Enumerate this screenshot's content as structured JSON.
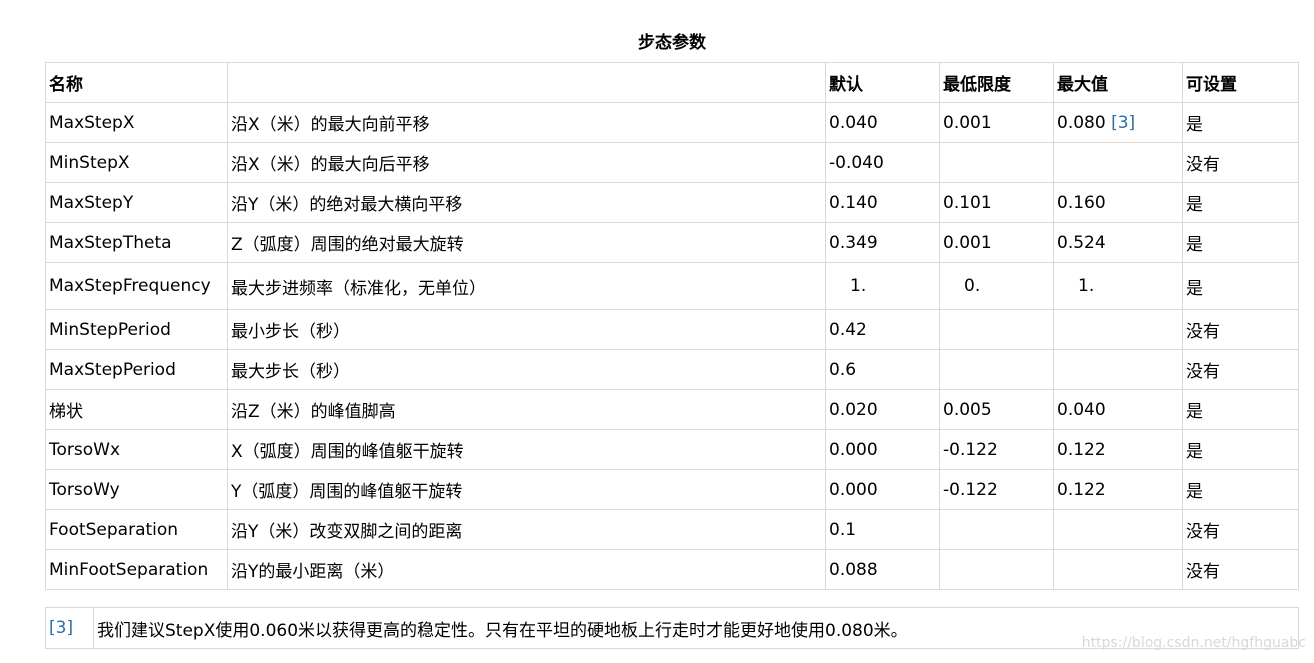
{
  "caption": "步态参数",
  "headers": [
    "名称",
    "",
    "默认",
    "最低限度",
    "最大值",
    "可设置"
  ],
  "rows": [
    {
      "name": "MaxStepX",
      "desc": "沿X（米）的最大向前平移",
      "default": "0.040",
      "min": "0.001",
      "max": "0.080",
      "max_ref": "[3]",
      "settable": "是"
    },
    {
      "name": "MinStepX",
      "desc": "沿X（米）的最大向后平移",
      "default": "-0.040",
      "min": "",
      "max": "",
      "max_ref": "",
      "settable": "没有"
    },
    {
      "name": "MaxStepY",
      "desc": "沿Y（米）的绝对最大横向平移",
      "default": "0.140",
      "min": "0.101",
      "max": "0.160",
      "max_ref": "",
      "settable": "是"
    },
    {
      "name": "MaxStepTheta",
      "desc": "Z（弧度）周围的绝对最大旋转",
      "default": "0.349",
      "min": "0.001",
      "max": "0.524",
      "max_ref": "",
      "settable": "是"
    },
    {
      "name": "MaxStepFrequency",
      "desc": "最大步进频率（标准化，无单位）",
      "default": "1.",
      "min": "0.",
      "max": "1.",
      "max_ref": "",
      "settable": "是"
    },
    {
      "name": "MinStepPeriod",
      "desc": "最小步长（秒）",
      "default": "0.42",
      "min": "",
      "max": "",
      "max_ref": "",
      "settable": "没有"
    },
    {
      "name": "MaxStepPeriod",
      "desc": "最大步长（秒）",
      "default": "0.6",
      "min": "",
      "max": "",
      "max_ref": "",
      "settable": "没有"
    },
    {
      "name": "梯状",
      "desc": "沿Z（米）的峰值脚高",
      "default": "0.020",
      "min": "0.005",
      "max": "0.040",
      "max_ref": "",
      "settable": "是"
    },
    {
      "name": "TorsoWx",
      "desc": "X（弧度）周围的峰值躯干旋转",
      "default": "0.000",
      "min": "-0.122",
      "max": "0.122",
      "max_ref": "",
      "settable": "是"
    },
    {
      "name": "TorsoWy",
      "desc": "Y（弧度）周围的峰值躯干旋转",
      "default": "0.000",
      "min": "-0.122",
      "max": "0.122",
      "max_ref": "",
      "settable": "是"
    },
    {
      "name": "FootSeparation",
      "desc": "沿Y（米）改变双脚之间的距离",
      "default": "0.1",
      "min": "",
      "max": "",
      "max_ref": "",
      "settable": "没有"
    },
    {
      "name": "MinFootSeparation",
      "desc": "沿Y的最小距离（米）",
      "default": "0.088",
      "min": "",
      "max": "",
      "max_ref": "",
      "settable": "没有"
    }
  ],
  "footnote": {
    "ref": "[3]",
    "text": "我们建议StepX使用0.060米以获得更高的稳定性。只有在平坦的硬地板上行走时才能更好地使用0.080米。"
  },
  "watermark": "https://blog.csdn.net/hgfhguabc"
}
